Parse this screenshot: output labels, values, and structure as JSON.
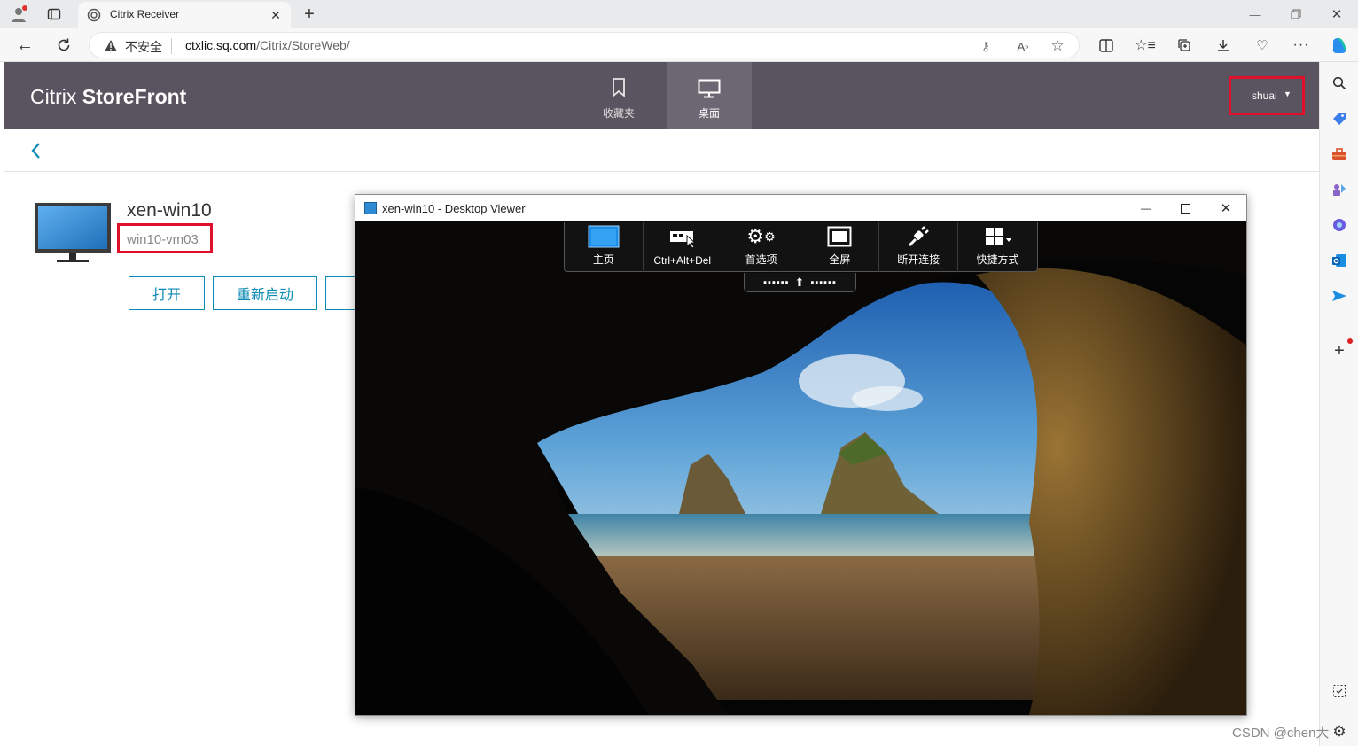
{
  "browser": {
    "tab_title": "Citrix Receiver",
    "security_label": "不安全",
    "url_host": "ctxlic.sq.com",
    "url_path": "/Citrix/StoreWeb/"
  },
  "storefront": {
    "brand_light": "Citrix",
    "brand_bold": "StoreFront",
    "nav": [
      {
        "label": "收藏夹",
        "icon": "bookmark-icon",
        "active": false
      },
      {
        "label": "桌面",
        "icon": "monitor-icon",
        "active": true
      }
    ],
    "user_menu": "shuai",
    "desktop": {
      "name": "xen-win10",
      "machine": "win10-vm03",
      "actions": [
        "打开",
        "重新启动"
      ]
    }
  },
  "viewer": {
    "title": "xen-win10 - Desktop Viewer",
    "toolbar": [
      {
        "label": "主页",
        "icon": "windows-home-icon"
      },
      {
        "label": "Ctrl+Alt+Del",
        "icon": "ctrl-alt-del-icon"
      },
      {
        "label": "首选项",
        "icon": "gears-icon"
      },
      {
        "label": "全屏",
        "icon": "fullscreen-icon"
      },
      {
        "label": "断开连接",
        "icon": "disconnect-plug-icon"
      },
      {
        "label": "快捷方式",
        "icon": "shortcuts-grid-icon"
      }
    ]
  },
  "watermark": "CSDN @chen大",
  "colors": {
    "storefront_header": "#5a5460",
    "storefront_nav_active": "#6d6773",
    "accent": "#0b8ab3",
    "highlight_box": "#e0102a"
  }
}
